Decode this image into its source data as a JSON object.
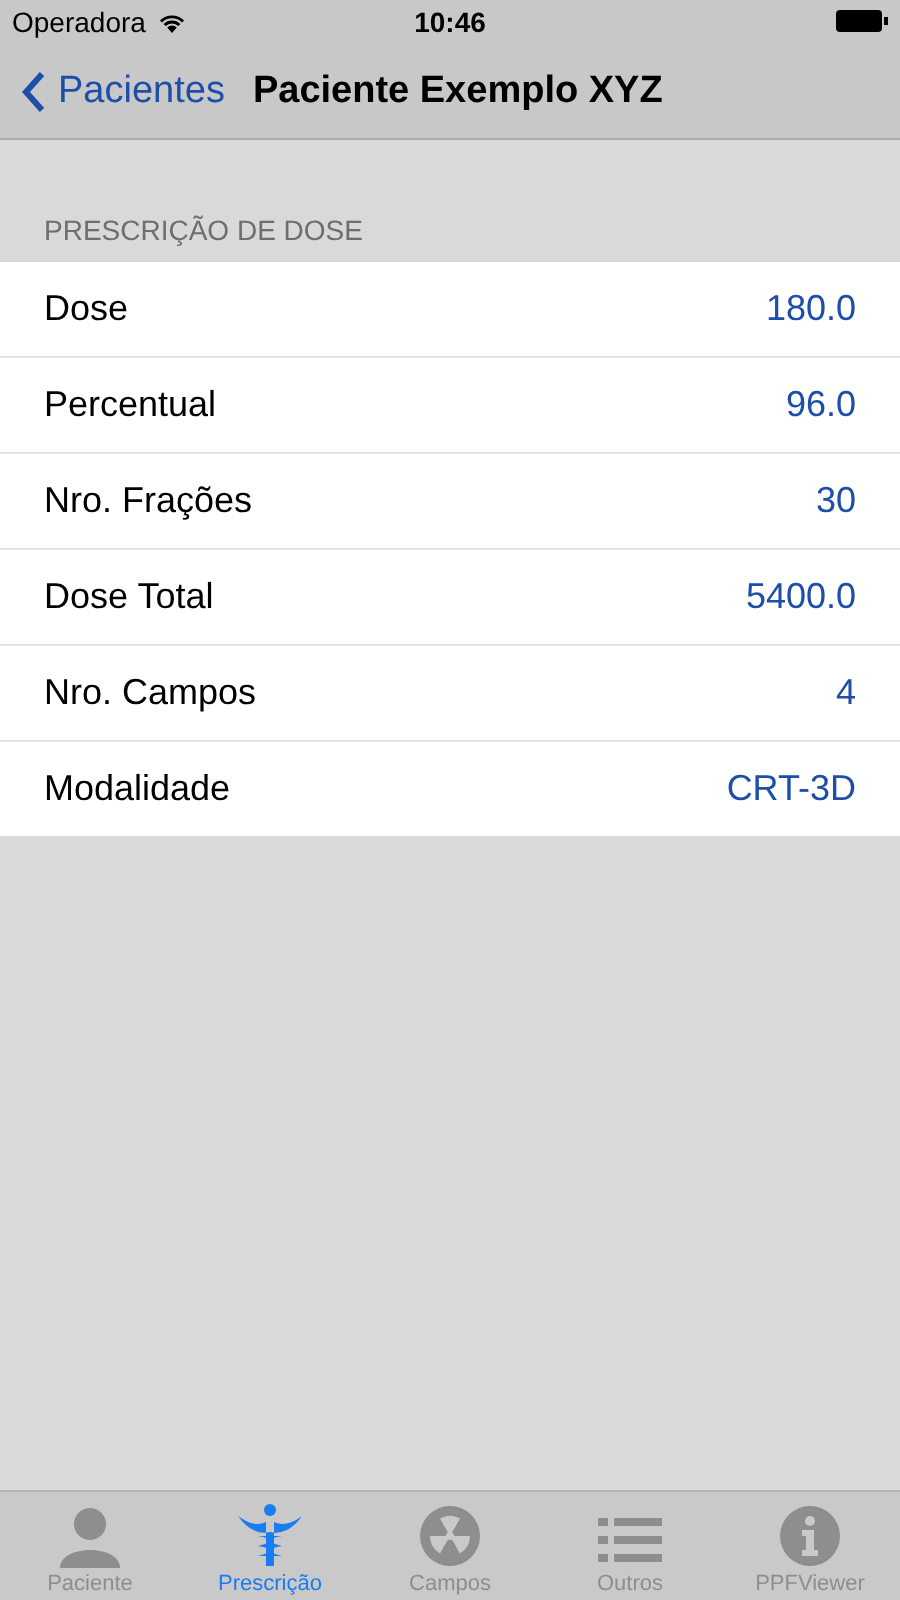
{
  "status_bar": {
    "carrier": "Operadora",
    "time": "10:46"
  },
  "nav": {
    "back": "Pacientes",
    "title": "Paciente Exemplo XYZ"
  },
  "section": {
    "header": "PRESCRIÇÃO DE DOSE",
    "rows": [
      {
        "label": "Dose",
        "value": "180.0"
      },
      {
        "label": "Percentual",
        "value": "96.0"
      },
      {
        "label": "Nro. Frações",
        "value": "30"
      },
      {
        "label": "Dose Total",
        "value": "5400.0"
      },
      {
        "label": "Nro. Campos",
        "value": "4"
      },
      {
        "label": "Modalidade",
        "value": "CRT-3D"
      }
    ]
  },
  "tabs": [
    {
      "label": "Paciente",
      "kind": "person",
      "selected": false
    },
    {
      "label": "Prescrição",
      "kind": "caduceus",
      "selected": true
    },
    {
      "label": "Campos",
      "kind": "radiation",
      "selected": false
    },
    {
      "label": "Outros",
      "kind": "list",
      "selected": false
    },
    {
      "label": "PPFViewer",
      "kind": "info",
      "selected": false
    }
  ]
}
